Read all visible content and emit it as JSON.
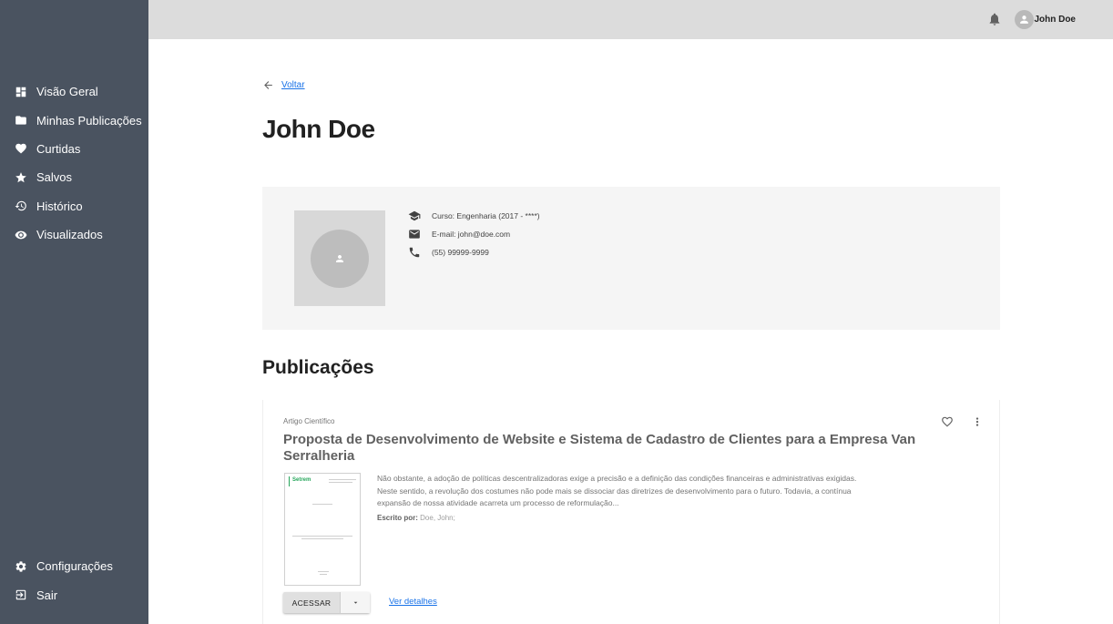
{
  "sidebar": {
    "items": [
      {
        "label": "Visão Geral",
        "icon": "dashboard-icon"
      },
      {
        "label": "Minhas Publicações",
        "icon": "folder-icon"
      },
      {
        "label": "Curtidas",
        "icon": "heart-icon"
      },
      {
        "label": "Salvos",
        "icon": "star-icon"
      },
      {
        "label": "Histórico",
        "icon": "history-icon"
      },
      {
        "label": "Visualizados",
        "icon": "eye-icon"
      }
    ],
    "bottom_items": [
      {
        "label": "Configurações",
        "icon": "gear-icon"
      },
      {
        "label": "Sair",
        "icon": "logout-icon"
      }
    ]
  },
  "topbar": {
    "user_name": "John Doe",
    "notification_icon": "bell-icon",
    "avatar_icon": "user-avatar-icon"
  },
  "back": {
    "label": "Voltar"
  },
  "profile": {
    "name": "John Doe",
    "course": "Curso: Engenharia (2017 - ****)",
    "email": "E-mail: john@doe.com",
    "phone": "(55) 99999-9999"
  },
  "publications": {
    "section_title": "Publicações",
    "items": [
      {
        "type": "Artigo Científico",
        "title": "Proposta de Desenvolvimento de Website e Sistema de Cadastro de Clientes para a Empresa Van Serralheria",
        "description": "Não obstante, a adoção de políticas descentralizadoras exige a precisão e a definição das condições financeiras e administrativas exigidas. Neste sentido, a revolução dos costumes não pode mais se dissociar das diretrizes de desenvolvimento para o futuro. Todavia, a contínua expansão de nossa atividade acarreta um processo de reformulação...",
        "author_label": "Escrito por:",
        "author": "Doe, John;",
        "thumbnail_logo": "Setrem",
        "access_label": "ACESSAR",
        "details_label": "Ver detalhes"
      }
    ]
  },
  "colors": {
    "sidebar_bg": "#4a5360",
    "topbar_bg": "#dcdcdc",
    "link": "#1a73e8",
    "card_bg": "#f5f5f5"
  }
}
